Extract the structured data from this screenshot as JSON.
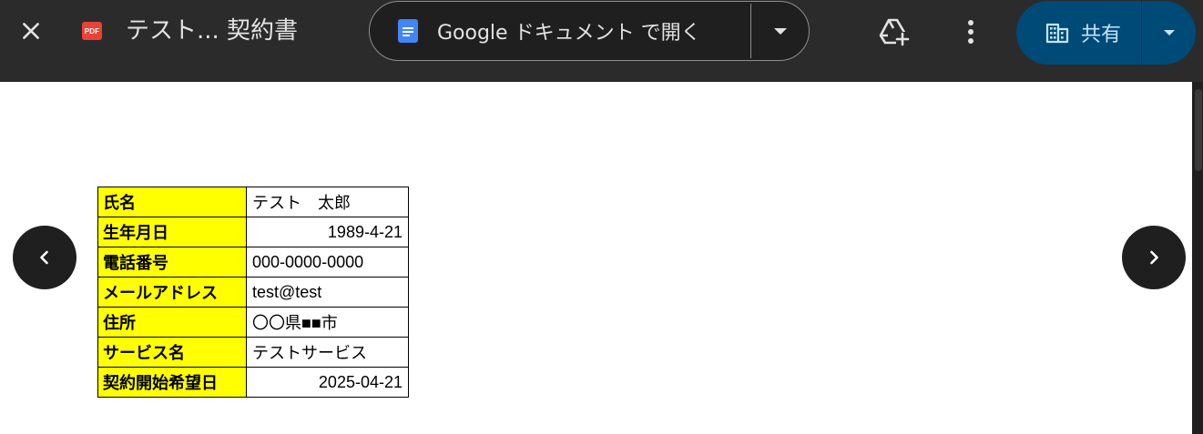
{
  "toolbar": {
    "pdf_badge": "PDF",
    "file_title": "テスト... 契約書",
    "open_with_label": "Google ドキュメント で開く",
    "share_label": "共有"
  },
  "icons": {
    "close": "close-icon",
    "file_type": "pdf-icon",
    "docs": "google-docs-icon",
    "add_drive": "add-to-drive-icon",
    "more": "more-vert-icon",
    "share": "building-icon",
    "prev": "chevron-left-icon",
    "next": "chevron-right-icon"
  },
  "colors": {
    "toolbar_bg": "#2b2b2b",
    "pdf_red": "#ea4335",
    "docs_blue": "#4285f4",
    "share_bg": "#004a77",
    "share_text": "#c2e7ff",
    "label_highlight": "#ffff00"
  },
  "document": {
    "rows": [
      {
        "label": "氏名",
        "value": "テスト　太郎"
      },
      {
        "label": "生年月日",
        "value": "1989-4-21"
      },
      {
        "label": "電話番号",
        "value": "000-0000-0000"
      },
      {
        "label": "メールアドレス",
        "value": "test@test"
      },
      {
        "label": "住所",
        "value": "〇〇県■■市"
      },
      {
        "label": "サービス名",
        "value": "テストサービス"
      },
      {
        "label": "契約開始希望日",
        "value": "2025-04-21"
      }
    ]
  }
}
